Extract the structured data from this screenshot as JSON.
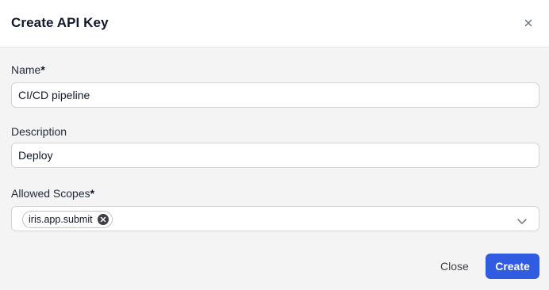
{
  "dialog": {
    "title": "Create API Key",
    "close_icon": "close-icon"
  },
  "form": {
    "name": {
      "label": "Name",
      "required_marker": "*",
      "value": "CI/CD pipeline"
    },
    "description": {
      "label": "Description",
      "value": "Deploy"
    },
    "scopes": {
      "label": "Allowed Scopes",
      "required_marker": "*",
      "selected": [
        "iris.app.submit"
      ],
      "dropdown_icon": "chevron-down-icon",
      "chip_remove_icon": "remove-chip-icon"
    }
  },
  "footer": {
    "close_label": "Close",
    "create_label": "Create"
  },
  "colors": {
    "primary": "#2f5ce0",
    "background": "#f4f4f5",
    "header_background": "#ffffff",
    "border": "#d4d4d8"
  }
}
